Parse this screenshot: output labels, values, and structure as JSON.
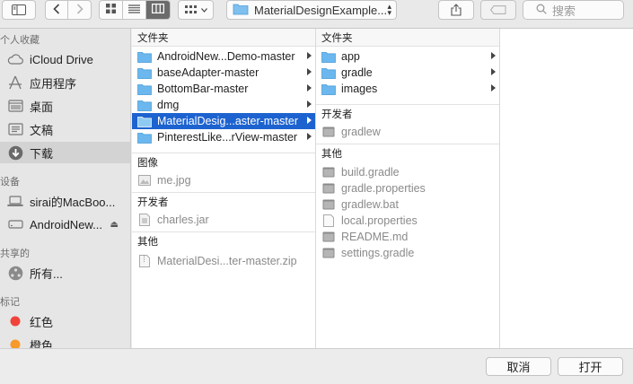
{
  "toolbar": {
    "path_label": "MaterialDesignExample...",
    "search_placeholder": "搜索"
  },
  "sidebar": {
    "section_favorites": "个人收藏",
    "favorites": [
      {
        "label": "iCloud Drive",
        "icon": "cloud-icon"
      },
      {
        "label": "应用程序",
        "icon": "applications-icon"
      },
      {
        "label": "桌面",
        "icon": "desktop-icon"
      },
      {
        "label": "文稿",
        "icon": "documents-icon"
      },
      {
        "label": "下载",
        "icon": "downloads-icon",
        "selected": true
      }
    ],
    "section_devices": "设备",
    "devices": [
      {
        "label": "sirai的MacBoo...",
        "icon": "laptop-icon"
      },
      {
        "label": "AndroidNew...",
        "icon": "drive-icon",
        "eject": "⏏"
      }
    ],
    "section_shared": "共享的",
    "shared": [
      {
        "label": "所有...",
        "icon": "network-icon"
      }
    ],
    "section_tags": "标记",
    "tags": [
      {
        "label": "红色",
        "color": "#f0443b"
      },
      {
        "label": "橙色",
        "color": "#f79a2b"
      }
    ]
  },
  "column1": {
    "header": "文件夹",
    "folders": [
      {
        "label": "AndroidNew...Demo-master"
      },
      {
        "label": "baseAdapter-master"
      },
      {
        "label": "BottomBar-master"
      },
      {
        "label": "dmg"
      },
      {
        "label": "MaterialDesig...aster-master",
        "selected": true
      },
      {
        "label": "PinterestLike...rView-master"
      }
    ],
    "group_images": "图像",
    "images": [
      {
        "label": "me.jpg"
      }
    ],
    "group_developer": "开发者",
    "developer": [
      {
        "label": "charles.jar"
      }
    ],
    "group_other": "其他",
    "other": [
      {
        "label": "MaterialDesi...ter-master.zip"
      }
    ]
  },
  "column2": {
    "header": "文件夹",
    "folders": [
      {
        "label": "app"
      },
      {
        "label": "gradle"
      },
      {
        "label": "images"
      }
    ],
    "group_developer": "开发者",
    "developer": [
      {
        "label": "gradlew"
      }
    ],
    "group_other": "其他",
    "other": [
      {
        "label": "build.gradle"
      },
      {
        "label": "gradle.properties"
      },
      {
        "label": "gradlew.bat"
      },
      {
        "label": "local.properties"
      },
      {
        "label": "README.md"
      },
      {
        "label": "settings.gradle"
      }
    ]
  },
  "footer": {
    "cancel_label": "取消",
    "open_label": "打开"
  },
  "colors": {
    "selection": "#1d63d0",
    "folder": "#5aaee8"
  }
}
